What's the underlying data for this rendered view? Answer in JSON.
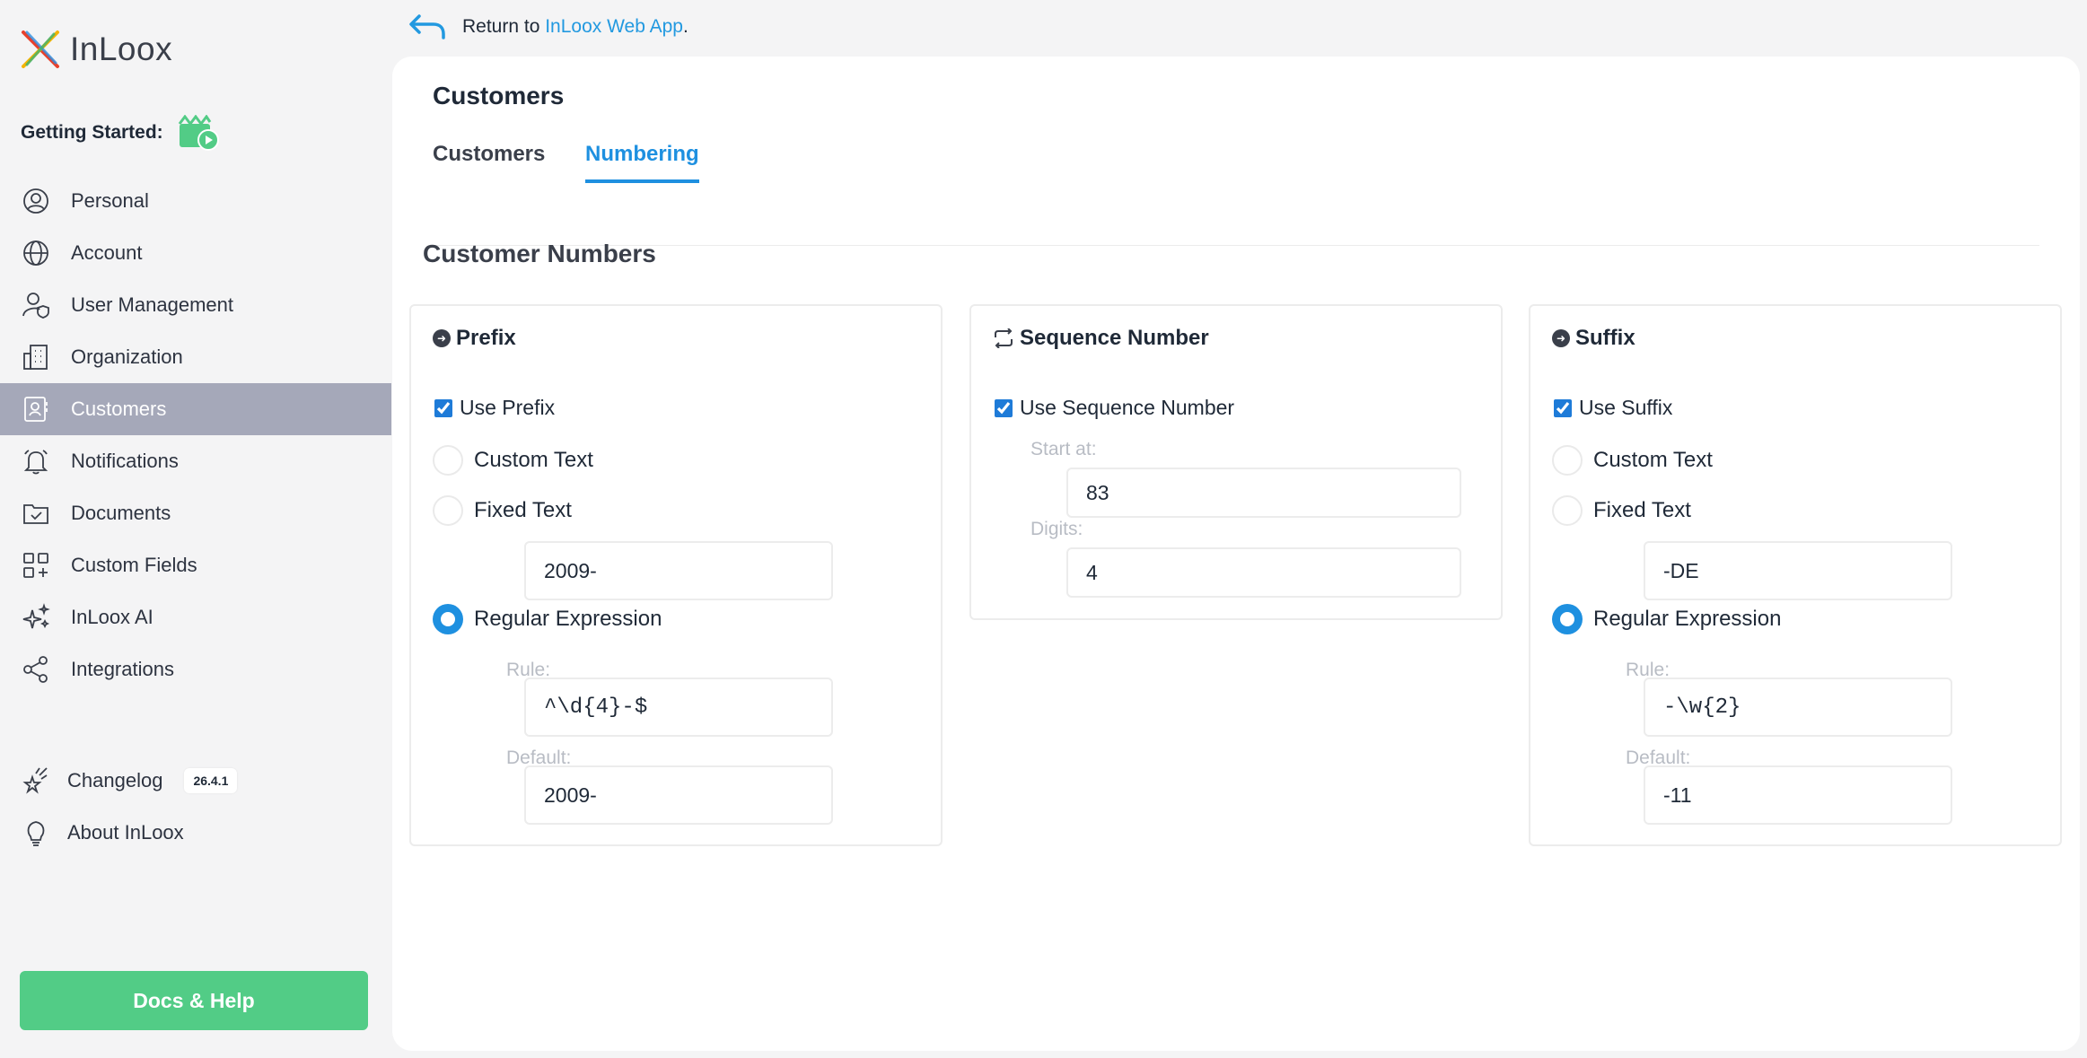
{
  "brand": {
    "name": "InLoox"
  },
  "sidebar": {
    "getting_started": "Getting Started:",
    "items": [
      {
        "label": "Personal",
        "icon": "user-circle-icon"
      },
      {
        "label": "Account",
        "icon": "globe-icon"
      },
      {
        "label": "User Management",
        "icon": "user-shield-icon"
      },
      {
        "label": "Organization",
        "icon": "building-icon"
      },
      {
        "label": "Customers",
        "icon": "contact-card-icon",
        "active": true
      },
      {
        "label": "Notifications",
        "icon": "bell-icon"
      },
      {
        "label": "Documents",
        "icon": "document-check-icon"
      },
      {
        "label": "Custom Fields",
        "icon": "grid-plus-icon"
      },
      {
        "label": "InLoox AI",
        "icon": "sparkles-icon"
      },
      {
        "label": "Integrations",
        "icon": "share-nodes-icon"
      }
    ],
    "changelog": {
      "label": "Changelog",
      "version": "26.4.1"
    },
    "about": {
      "label": "About InLoox"
    },
    "docs_button": "Docs & Help"
  },
  "return_bar": {
    "prefix": "Return to ",
    "link": "InLoox Web App",
    "suffix": "."
  },
  "main": {
    "title": "Customers",
    "tabs": [
      {
        "label": "Customers"
      },
      {
        "label": "Numbering",
        "active": true
      }
    ],
    "section_title": "Customer Numbers",
    "prefix": {
      "title": "Prefix",
      "use_label": "Use Prefix",
      "custom_text": "Custom Text",
      "fixed_text": "Fixed Text",
      "fixed_value": "2009-",
      "regex": "Regular Expression",
      "rule_label": "Rule:",
      "rule_value": "^\\d{4}-$",
      "default_label": "Default:",
      "default_value": "2009-"
    },
    "sequence": {
      "title": "Sequence Number",
      "use_label": "Use Sequence Number",
      "start_label": "Start at:",
      "start_value": "83",
      "digits_label": "Digits:",
      "digits_value": "4"
    },
    "suffix": {
      "title": "Suffix",
      "use_label": "Use Suffix",
      "custom_text": "Custom Text",
      "fixed_text": "Fixed Text",
      "fixed_value": "-DE",
      "regex": "Regular Expression",
      "rule_label": "Rule:",
      "rule_value": "-\\w{2}",
      "default_label": "Default:",
      "default_value": "-11"
    }
  },
  "colors": {
    "accent": "#1e90e0",
    "docs_button": "#52cc86",
    "active_nav": "#a5a8b9"
  }
}
